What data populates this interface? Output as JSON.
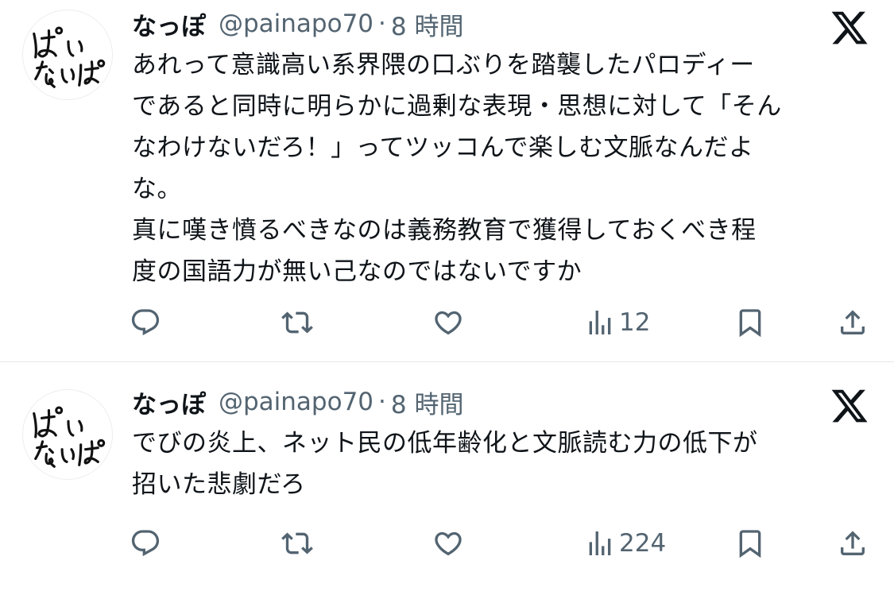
{
  "tweets": [
    {
      "author_name": "なっぽ",
      "handle": "@painapo70",
      "separator": "·",
      "time": "8 時間",
      "body": "あれって意識高い系界隈の口ぶりを踏襲したパロディー\nであると同時に明らかに過剰な表現・思想に対して「そん\nなわけないだろ！」ってツッコんで楽しむ文脈なんだよ\nな。\n真に嘆き憤るべきなのは義務教育で獲得しておくべき程\n度の国語力が無い己なのではないですか",
      "views": "12"
    },
    {
      "author_name": "なっぽ",
      "handle": "@painapo70",
      "separator": "·",
      "time": "8 時間",
      "body": "でびの炎上、ネット民の低年齢化と文脈読む力の低下が\n招いた悲劇だろ",
      "views": "224"
    }
  ],
  "icons": {
    "reply": "reply-icon",
    "retweet": "retweet-icon",
    "like": "like-icon",
    "views": "views-icon",
    "bookmark": "bookmark-icon",
    "share": "share-icon",
    "brand": "x-logo-icon"
  },
  "colors": {
    "text": "#0f1419",
    "secondary": "#536471",
    "divider": "#e6e6e6"
  }
}
